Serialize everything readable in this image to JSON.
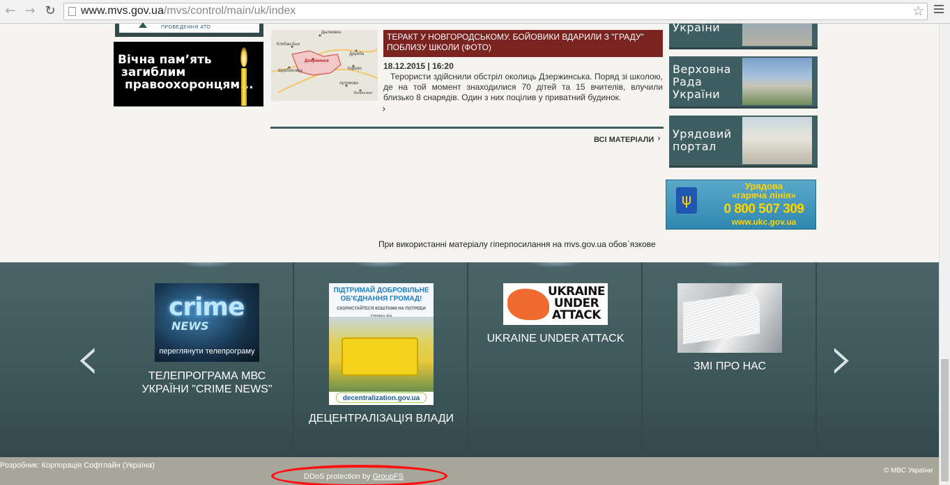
{
  "browser": {
    "url_host": "www.mvs.gov.ua",
    "url_path": "/mvs/control/main/uk/index",
    "back_glyph": "←",
    "forward_glyph": "→",
    "reload_glyph": "↻",
    "star_glyph": "☆"
  },
  "left": {
    "ato_caption": "ПРОВЕДЕННЯ АТО",
    "memorial_lines": [
      "Вічна пам’ять",
      "загиблим",
      "правоохоронцям..."
    ]
  },
  "news": {
    "map_labels": [
      "Дылеевка",
      "Клебан-Бык",
      "Дружба",
      "Щербиновка",
      "Дзержинск",
      "Кирово",
      "Артемово",
      "Ленинское"
    ],
    "title": "ТЕРАКТ У НОВГОРОДСЬКОМУ. БОЙОВИКИ ВДАРИЛИ З \"ГРАДУ\" ПОБЛИЗУ ШКОЛИ (ФОТО)",
    "date": "18.12.2015 | 16:20",
    "body": "Терористи здійснили обстріл околиць Дзержинська. Поряд зі школою, де на той момент знаходилися 70 дітей та 15 вчителів, влучили близько 8 снарядів. Один з них поцілив у приватний будинок.",
    "more_glyph": "›",
    "all_materials": "ВСІ МАТЕРІАЛИ",
    "all_arrow": "›"
  },
  "right_banners": [
    {
      "label": "України"
    },
    {
      "label_lines": [
        "Верховна",
        "Рада",
        "України"
      ]
    },
    {
      "label_lines": [
        "Урядовий",
        "портал"
      ]
    }
  ],
  "hotline": {
    "title_lines": [
      "Урядова",
      "«гаряча лінія»"
    ],
    "phone": "0 800 507 309",
    "site": "www.ukc.gov.ua",
    "coat_glyph": "ψ"
  },
  "notice": "При використанні матеріалу гіперпосилання на mvs.gov.ua обов`язкове",
  "carousel": {
    "prev_glyph": "‹",
    "next_glyph": "›",
    "items": [
      {
        "image_word1": "crime",
        "image_word2": "NEWS",
        "image_caption": "переглянути телепрограму",
        "label": "ТЕЛЕПРОГРАМА МВС УКРАЇНИ \"CRIME NEWS\""
      },
      {
        "image_top": "ПІДТРИМАЙ ДОБРОВІЛЬНЕ ОБ'ЄДНАННЯ ГРОМАД!",
        "image_sub": "СКОРИСТАЙТЕСЯ КОШТАМИ НА ПОТРЕБИ ГРОМАДИ",
        "image_foot": "decentralization.gov.ua",
        "label": "ДЕЦЕНТРАЛІЗАЦІЯ ВЛАДИ"
      },
      {
        "image_text": "UKRAINE UNDER ATTACK",
        "label": "UKRAINE UNDER ATTACK"
      },
      {
        "label": "ЗМІ ПРО НАС"
      }
    ]
  },
  "footer": {
    "developer": "Розробник: Корпорація Софтлайн (Україна)",
    "copyright": "© МВС України",
    "ddos_prefix": "DDoS protection by ",
    "ddos_link": "GroupFS"
  },
  "colors": {
    "accent_dark_teal": "#3f5e61",
    "news_title_bg": "#7a2320",
    "annotation_red": "#ff1010"
  }
}
